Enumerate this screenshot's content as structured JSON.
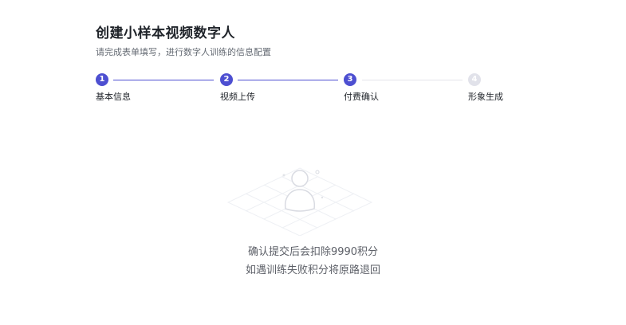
{
  "header": {
    "title": "创建小样本视频数字人",
    "subtitle": "请完成表单填写，进行数字人训练的信息配置"
  },
  "steps": [
    {
      "number": "1",
      "label": "基本信息",
      "state": "done"
    },
    {
      "number": "2",
      "label": "视频上传",
      "state": "done"
    },
    {
      "number": "3",
      "label": "付费确认",
      "state": "current"
    },
    {
      "number": "4",
      "label": "形象生成",
      "state": "pending"
    }
  ],
  "content": {
    "illustration_icon": "user-placeholder-icon",
    "message_line1": "确认提交后会扣除9990积分",
    "message_line2": "如遇训练失败积分将原路退回"
  },
  "colors": {
    "accent": "#4d4fd1",
    "pending": "#e1e2ea",
    "text_primary": "#1f2329",
    "text_secondary": "#646a73"
  }
}
